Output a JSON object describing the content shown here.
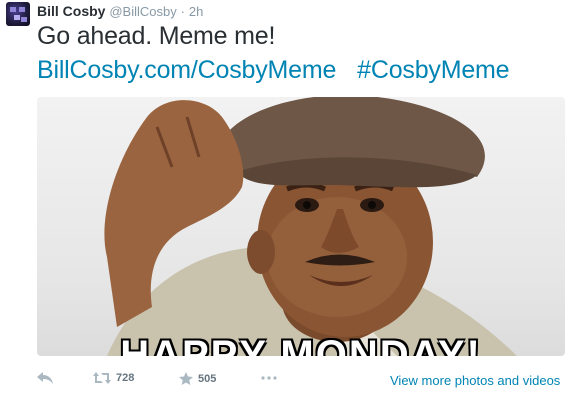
{
  "tweet": {
    "author_name": "Bill Cosby",
    "author_handle": "@BillCosby",
    "separator": "·",
    "time": "2h",
    "text": "Go ahead. Meme me!",
    "link": "BillCosby.com/CosbyMeme",
    "hashtag": "#CosbyMeme",
    "image_caption": "HAPPY MONDAY!"
  },
  "actions": {
    "reply_icon": "reply-icon",
    "retweet_icon": "retweet-icon",
    "retweet_count": "728",
    "favorite_icon": "star-icon",
    "favorite_count": "505",
    "more_icon": "more-icon",
    "view_more_label": "View more photos and videos"
  },
  "colors": {
    "link": "#0084b4",
    "muted": "#8899a6",
    "text": "#292f33"
  }
}
